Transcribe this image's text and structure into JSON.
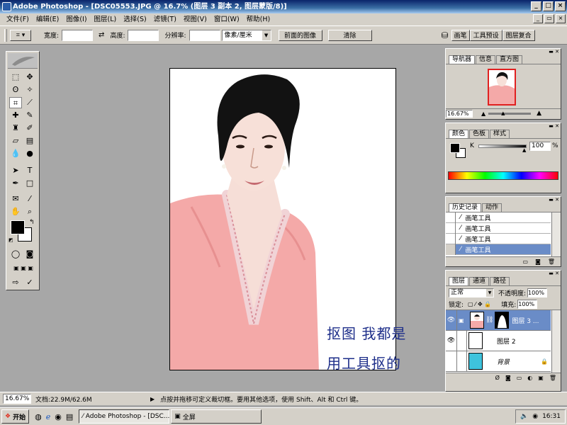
{
  "title": "Adobe Photoshop - [DSC05553.JPG @ 16.7% (图层 3 副本 2, 图层蒙版/8)]",
  "menu": [
    "文件(F)",
    "编辑(E)",
    "图像(I)",
    "图层(L)",
    "选择(S)",
    "滤镜(T)",
    "视图(V)",
    "窗口(W)",
    "帮助(H)"
  ],
  "options": {
    "width_label": "宽度:",
    "height_label": "高度:",
    "resolution_label": "分辨率:",
    "unit_value": "像素/厘米",
    "front_image_button": "前面的图像",
    "clear_button": "清除",
    "palette_tabs": [
      "画笔",
      "工具预设",
      "图层复合"
    ]
  },
  "navigator": {
    "tabs": [
      "导航器",
      "信息",
      "直方图"
    ],
    "zoom": "16.67%"
  },
  "color": {
    "tabs": [
      "颜色",
      "色板",
      "样式"
    ],
    "channel": "K",
    "value": "100",
    "unit": "%"
  },
  "history": {
    "tabs": [
      "历史记录",
      "动作"
    ],
    "items": [
      "画笔工具",
      "画笔工具",
      "画笔工具",
      "画笔工具"
    ]
  },
  "layers": {
    "tabs": [
      "图层",
      "通道",
      "路径"
    ],
    "blend_mode": "正常",
    "opacity_label": "不透明度:",
    "opacity": "100%",
    "lock_label": "锁定:",
    "fill_label": "填充:",
    "fill": "100%",
    "items": [
      "图层 3 ...",
      "图层 2",
      "背景"
    ]
  },
  "canvas_text": {
    "line1": "抠图  我都是",
    "line2": "用工具抠的"
  },
  "status": {
    "zoom": "16.67%",
    "doc": "文档:22.9M/62.6M",
    "hint": "点按并拖移可定义裁切框。要用其他选项，使用 Shift、Alt 和 Ctrl 键。"
  },
  "taskbar": {
    "start": "开始",
    "task1": "Adobe Photoshop - [DSC...",
    "task2": "全屏",
    "clock": "16:31"
  },
  "colors": {
    "title_blue": "#0a246a",
    "selected_row": "#6a8cc7",
    "canvas_text": "#1e2f8a",
    "sweater_pink": "#f4a9a8"
  }
}
